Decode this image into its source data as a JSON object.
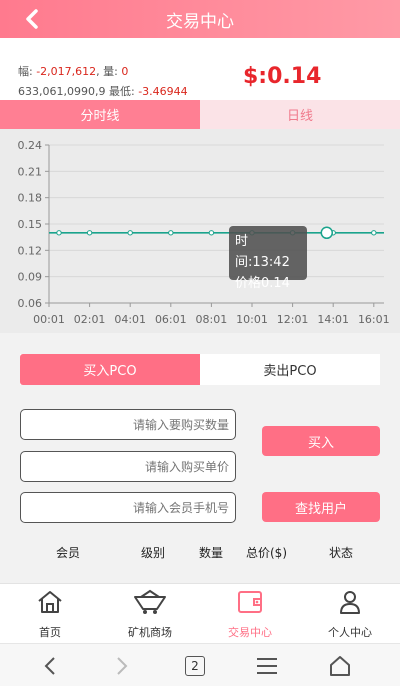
{
  "header": {
    "title": "交易中心"
  },
  "stats": {
    "line1_label_fu": "幅: ",
    "fu_value": "-2,017,612",
    "line1_label_liang": ", 量: ",
    "liang_value": "0",
    "line2_overlap": "633,061,0990,9",
    "line2_label_low": " 最低: ",
    "low_value": "-3.46944",
    "price": "$:0.14"
  },
  "kline_tabs": [
    {
      "label": "分时线",
      "active": true
    },
    {
      "label": "日线",
      "active": false
    }
  ],
  "chart_data": {
    "type": "line",
    "x": [
      "00:01",
      "02:01",
      "04:01",
      "06:01",
      "08:01",
      "10:01",
      "12:01",
      "14:01",
      "16:01"
    ],
    "y_ticks": [
      "0.24",
      "0.21",
      "0.18",
      "0.15",
      "0.12",
      "0.09",
      "0.06"
    ],
    "ylim": [
      0.06,
      0.24
    ],
    "series": [
      {
        "values": [
          0.14,
          0.14,
          0.14,
          0.14,
          0.14,
          0.14,
          0.14,
          0.14,
          0.14
        ]
      }
    ],
    "highlight_time": "13:42",
    "highlight_value": 0.14,
    "color": "#1aa38c"
  },
  "tooltip": {
    "line1": "时间:13:42",
    "line2": "价格0.14"
  },
  "trade_tabs": [
    {
      "label": "买入PCO",
      "active": true
    },
    {
      "label": "卖出PCO",
      "active": false
    }
  ],
  "form": {
    "qty_placeholder": "请输入要购买数量",
    "price_placeholder": "请输入购买单价",
    "phone_placeholder": "请输入会员手机号",
    "buy_label": "买入",
    "find_label": "查找用户"
  },
  "table_headers": [
    "会员",
    "级别",
    "数量",
    "总价($)",
    "状态"
  ],
  "tabbar": [
    {
      "label": "首页",
      "icon": "home-icon",
      "active": false
    },
    {
      "label": "矿机商场",
      "icon": "mining-cart-icon",
      "active": false
    },
    {
      "label": "交易中心",
      "icon": "wallet-icon",
      "active": true
    },
    {
      "label": "个人中心",
      "icon": "person-icon",
      "active": false
    }
  ],
  "browser": {
    "tab_count": "2"
  },
  "colors": {
    "accent": "#ff6f85",
    "price_red": "#e8262c",
    "line": "#1aa38c"
  }
}
